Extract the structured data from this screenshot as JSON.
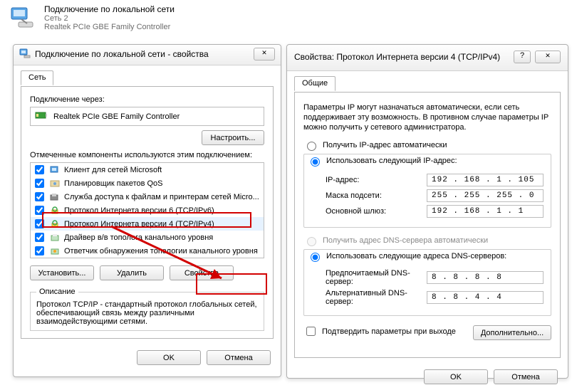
{
  "header": {
    "title": "Подключение по локальной сети",
    "subtitle": "Сеть 2",
    "device": "Realtek PCIe GBE Family Controller"
  },
  "leftWin": {
    "title": "Подключение по локальной сети - свойства",
    "tab": "Сеть",
    "connectUsing": "Подключение через:",
    "adapter": "Realtek PCIe GBE Family Controller",
    "configureBtn": "Настроить...",
    "componentsLabel": "Отмеченные компоненты используются этим подключением:",
    "items": [
      {
        "label": "Клиент для сетей Microsoft"
      },
      {
        "label": "Планировщик пакетов QoS"
      },
      {
        "label": "Служба доступа к файлам и принтерам сетей Micro..."
      },
      {
        "label": "Протокол Интернета версии 6 (TCP/IPv6)"
      },
      {
        "label": "Протокол Интернета версии 4 (TCP/IPv4)"
      },
      {
        "label": "Драйвер в/в тополога канального уровня"
      },
      {
        "label": "Ответчик обнаружения топологии канального уровня"
      }
    ],
    "installBtn": "Установить...",
    "removeBtn": "Удалить",
    "propsBtn": "Свойства",
    "descLegend": "Описание",
    "descText": "Протокол TCP/IP - стандартный протокол глобальных сетей, обеспечивающий связь между различными взаимодействующими сетями.",
    "ok": "OK",
    "cancel": "Отмена"
  },
  "rightWin": {
    "title": "Свойства: Протокол Интернета версии 4 (TCP/IPv4)",
    "tab": "Общие",
    "intro": "Параметры IP могут назначаться автоматически, если сеть поддерживает эту возможность. В противном случае параметры IP можно получить у сетевого администратора.",
    "radioAutoIp": "Получить IP-адрес автоматически",
    "radioManualIp": "Использовать следующий IP-адрес:",
    "ipLabel": "IP-адрес:",
    "ipVal": "192 . 168 .  1  . 105",
    "maskLabel": "Маска подсети:",
    "maskVal": "255 . 255 . 255 .  0",
    "gwLabel": "Основной шлюз:",
    "gwVal": "192 . 168 .  1  .  1",
    "radioAutoDns": "Получить адрес DNS-сервера автоматически",
    "radioManualDns": "Использовать следующие адреса DNS-серверов:",
    "dns1Label": "Предпочитаемый DNS-сервер:",
    "dns1Val": "8  .  8  .  8  .  8",
    "dns2Label": "Альтернативный DNS-сервер:",
    "dns2Val": "8  .  8  .  4  .  4",
    "confirmExit": "Подтвердить параметры при выходе",
    "advancedBtn": "Дополнительно...",
    "ok": "OK",
    "cancel": "Отмена"
  }
}
